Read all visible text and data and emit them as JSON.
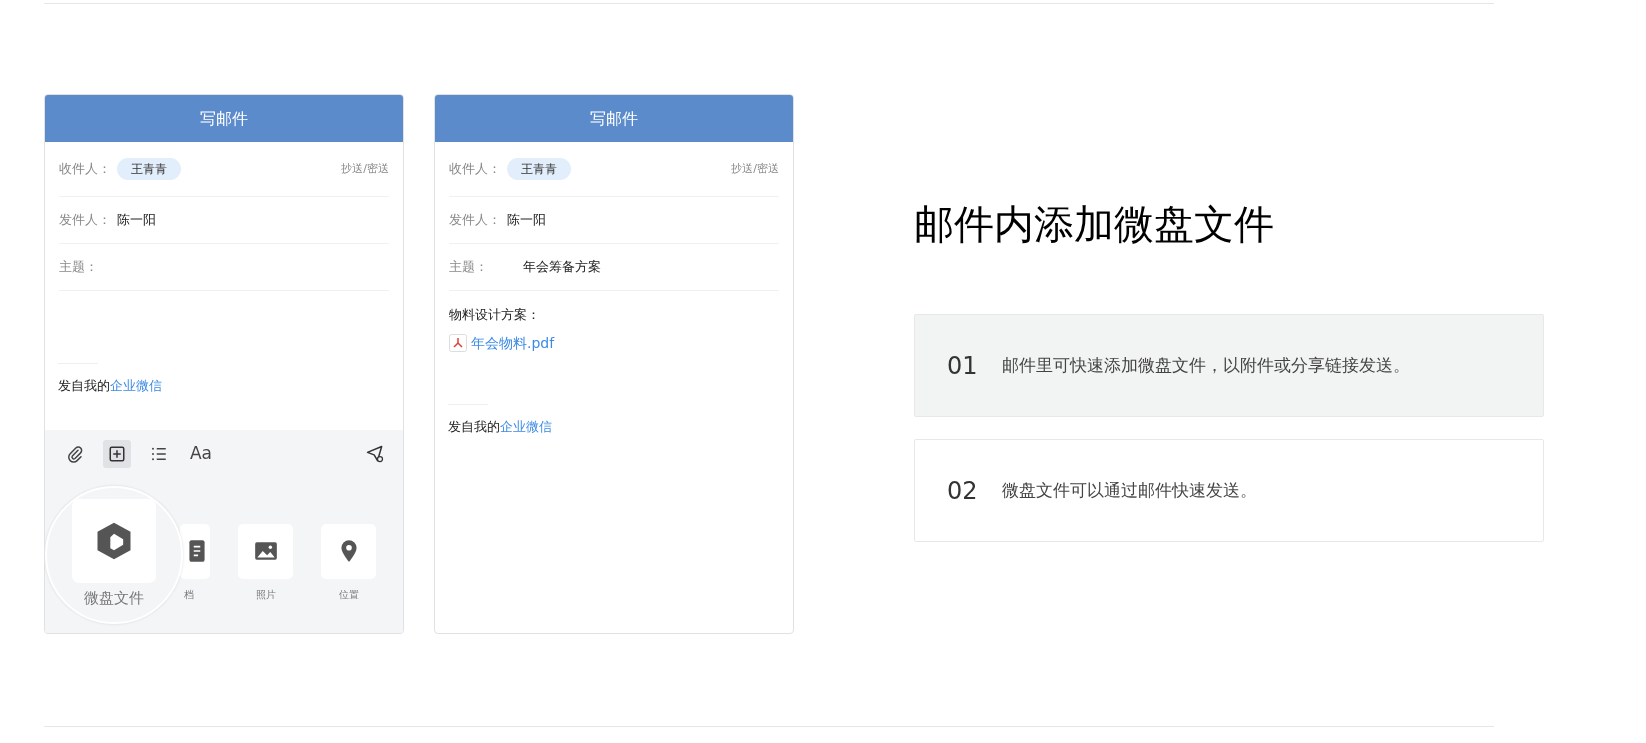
{
  "phones": [
    {
      "header": "写邮件",
      "to_label": "收件人：",
      "recipient": "王青青",
      "cc_link": "抄送/密送",
      "from_label": "发件人：",
      "sender": "陈一阳",
      "subject_label": "主题：",
      "signature": {
        "prefix": "发自我的",
        "link": "企业微信"
      },
      "toolbar": {
        "tools": [
          {
            "kind": "attach",
            "selected": false
          },
          {
            "kind": "insert",
            "selected": true
          },
          {
            "kind": "list",
            "selected": false
          },
          {
            "kind": "font",
            "label": "Aa",
            "selected": false
          }
        ],
        "tiles": [
          {
            "kind": "drive",
            "label": "微盘文件",
            "magnified": true
          },
          {
            "kind": "document",
            "label": "档",
            "magnified": false
          },
          {
            "kind": "photo",
            "label": "照片",
            "magnified": false
          },
          {
            "kind": "location",
            "label": "位置",
            "magnified": false
          }
        ]
      }
    },
    {
      "header": "写邮件",
      "to_label": "收件人：",
      "recipient": "王青青",
      "cc_link": "抄送/密送",
      "from_label": "发件人：",
      "sender": "陈一阳",
      "subject_label": "主题：",
      "subject": "年会筹备方案",
      "body": {
        "text": "物料设计方案：",
        "attachment": "年会物料.pdf"
      },
      "signature": {
        "prefix": "发自我的",
        "link": "企业微信"
      }
    }
  ],
  "feature": {
    "title": "邮件内添加微盘文件",
    "steps": [
      {
        "number": "01",
        "text": "邮件里可快速添加微盘文件，以附件或分享链接发送。",
        "selected": true
      },
      {
        "number": "02",
        "text": "微盘文件可以通过邮件快速发送。",
        "selected": false
      }
    ]
  }
}
